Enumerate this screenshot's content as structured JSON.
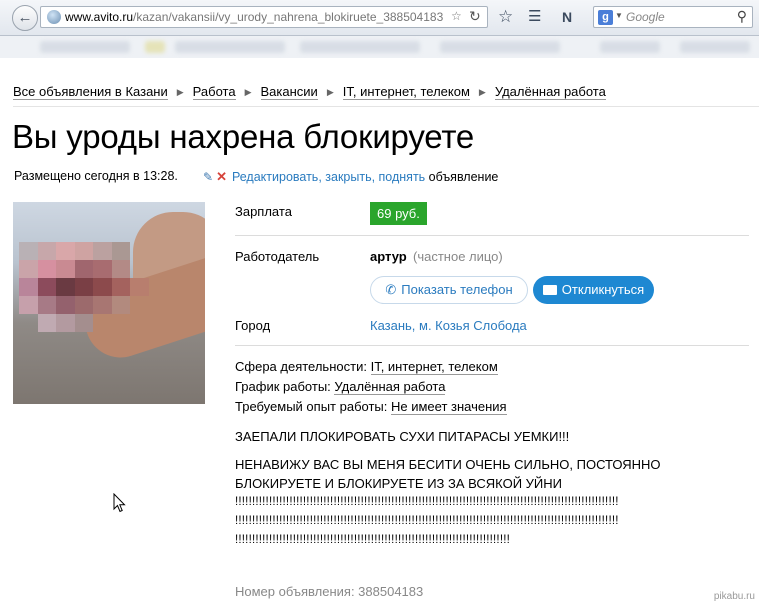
{
  "browser": {
    "url_domain": "www.avito.ru",
    "url_path": "/kazan/vakansii/vy_urody_nahrena_blokiruete_388504183",
    "search_placeholder": "Google",
    "search_engine_letter": "g"
  },
  "breadcrumb": [
    "Все объявления в Казани",
    "Работа",
    "Вакансии",
    "IT, интернет, телеком",
    "Удалённая работа"
  ],
  "listing": {
    "title": "Вы уроды нахрена блокируете",
    "posted": "Размещено сегодня в 13:28.",
    "edit_link": "Редактировать, закрыть, поднять",
    "edit_tail": "объявление",
    "salary_label": "Зарплата",
    "salary_value": "69 руб.",
    "employer_label": "Работодатель",
    "employer_name": "артур",
    "employer_type": "(частное лицо)",
    "show_phone_button": "Показать телефон",
    "respond_button": "Откликнуться",
    "city_label": "Город",
    "city_value": "Казань, м. Козья Слобода",
    "sphere_label": "Сфера деятельности:",
    "sphere_value": "IT, интернет, телеком",
    "schedule_label": "График работы:",
    "schedule_value": "Удалённая работа",
    "experience_label": "Требуемый опыт работы:",
    "experience_value": "Не имеет значения",
    "text_line1": "ЗАЕПАЛИ ПЛОКИРОВАТЬ СУХИ ПИТАРАСЫ УЕМКИ!!!",
    "text_line2": "НЕНАВИЖУ ВАС ВЫ МЕНЯ БЕСИТИ ОЧЕНЬ СИЛЬНО, ПОСТОЯННО",
    "text_line3": "БЛОКИРУЕТЕ И БЛОКИРУЕТЕ ИЗ ЗА ВСЯКОЙ УЙНИ",
    "text_line4": "!!!!!!!!!!!!!!!!!!!!!!!!!!!!!!!!!!!!!!!!!!!!!!!!!!!!!!!!!!!!!!!!!!!!!!!!!!!!!!!!!!!!!!!!!!!!!!!!!!!!!!!!!!!!!!!!!",
    "text_line5": "!!!!!!!!!!!!!!!!!!!!!!!!!!!!!!!!!!!!!!!!!!!!!!!!!!!!!!!!!!!!!!!!!!!!!!!!!!!!!!!!!!!!!!!!!!!!!!!!!!!!!!!!!!!!!!!!!",
    "text_line6": "!!!!!!!!!!!!!!!!!!!!!!!!!!!!!!!!!!!!!!!!!!!!!!!!!!!!!!!!!!!!!!!!!!!!!!!!!!!!!!!!!",
    "ad_number": "Номер объявления: 388504183"
  },
  "watermark": "pikabu.ru",
  "colors": {
    "link": "#2a7bbf",
    "salary_bg": "#2aa52c",
    "button_blue": "#1e88d2",
    "close_red": "#d6433a"
  }
}
